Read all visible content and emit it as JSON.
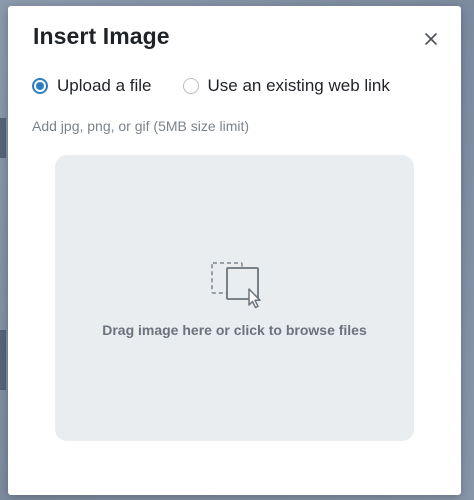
{
  "dialog": {
    "title": "Insert Image",
    "close_icon": "close-icon"
  },
  "source_options": [
    {
      "label": "Upload a file",
      "selected": true
    },
    {
      "label": "Use an existing web link",
      "selected": false
    }
  ],
  "hint": "Add jpg, png, or gif (5MB size limit)",
  "dropzone": {
    "icon": "drag-drop-icon",
    "label": "Drag image here or click to browse files"
  },
  "colors": {
    "accent": "#2d7fbf",
    "dropzone_bg": "#eaedf0",
    "title_text": "#1f2328",
    "muted_text": "#7c838b"
  }
}
